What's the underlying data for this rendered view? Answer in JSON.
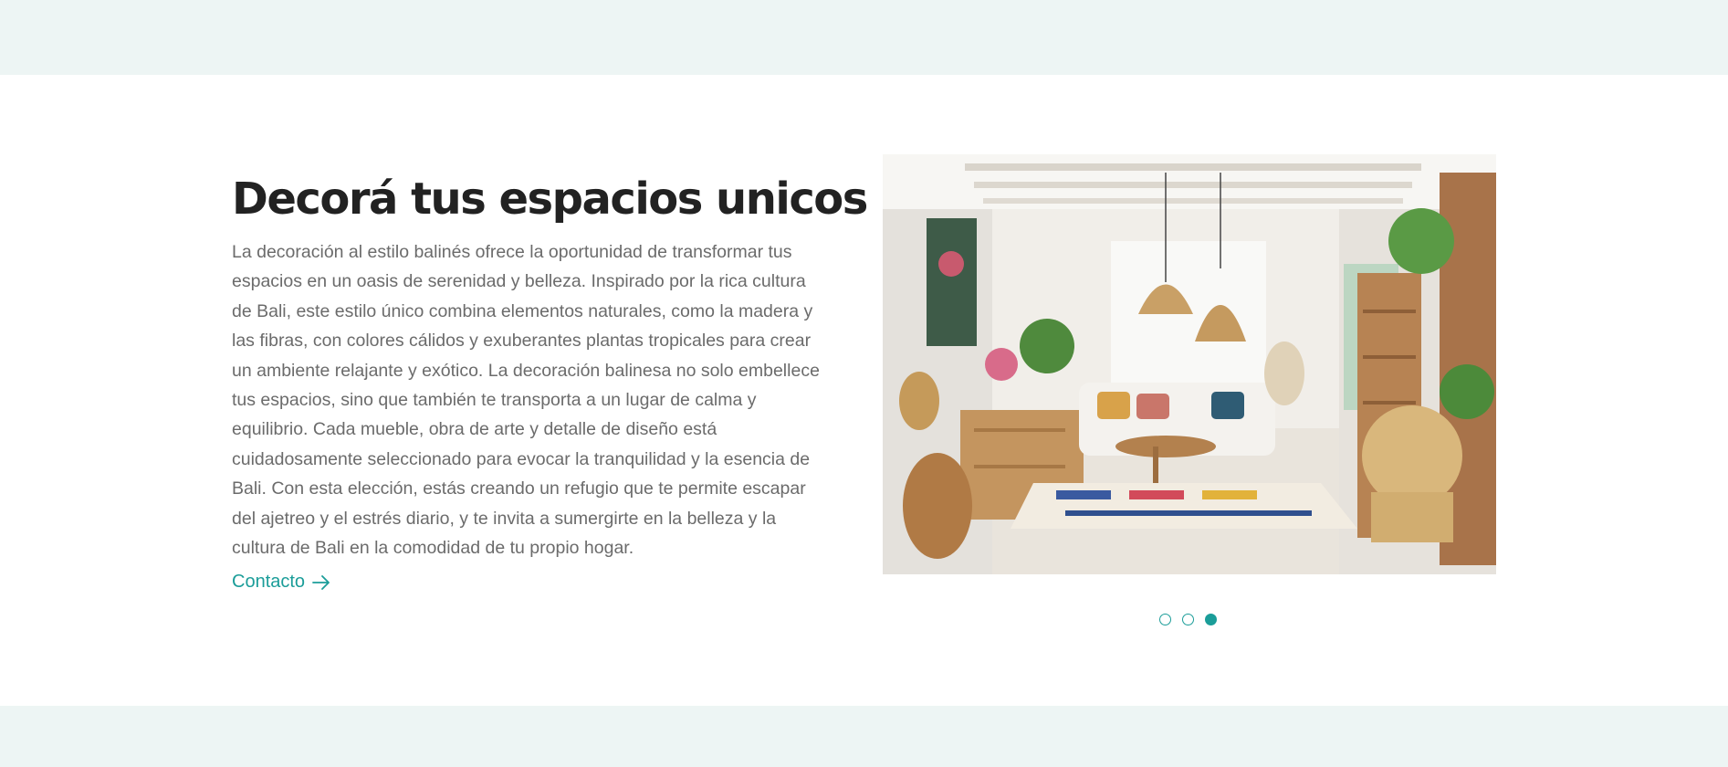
{
  "section": {
    "title": "Decorá tus espacios unicos",
    "body": "La decoración al estilo balinés ofrece la oportunidad de transformar tus espacios en un oasis de serenidad y belleza. Inspirado por la rica cultura de Bali, este estilo único combina elementos naturales, como la madera y las fibras, con colores cálidos y exuberantes plantas tropicales para crear un ambiente relajante y exótico. La decoración balinesa no solo embellece tus espacios, sino que también te transporta a un lugar de calma y equilibrio. Cada mueble, obra de arte y detalle de diseño está cuidadosamente seleccionado para evocar la tranquilidad y la esencia de Bali. Con esta elección, estás creando un refugio que te permite escapar del ajetreo y el estrés diario, y te invita a sumergirte en la belleza y la cultura de Bali en la comodidad de tu propio hogar.",
    "link_label": "Contacto",
    "link_icon": "arrow-right-icon"
  },
  "gallery": {
    "slide_count": 3,
    "active_slide": 3,
    "image_subject": "bali-style-living-room"
  },
  "colors": {
    "accent": "#1b9d99",
    "band_background": "#edf5f4",
    "title": "#222222",
    "body_text": "#6b6b6b"
  }
}
